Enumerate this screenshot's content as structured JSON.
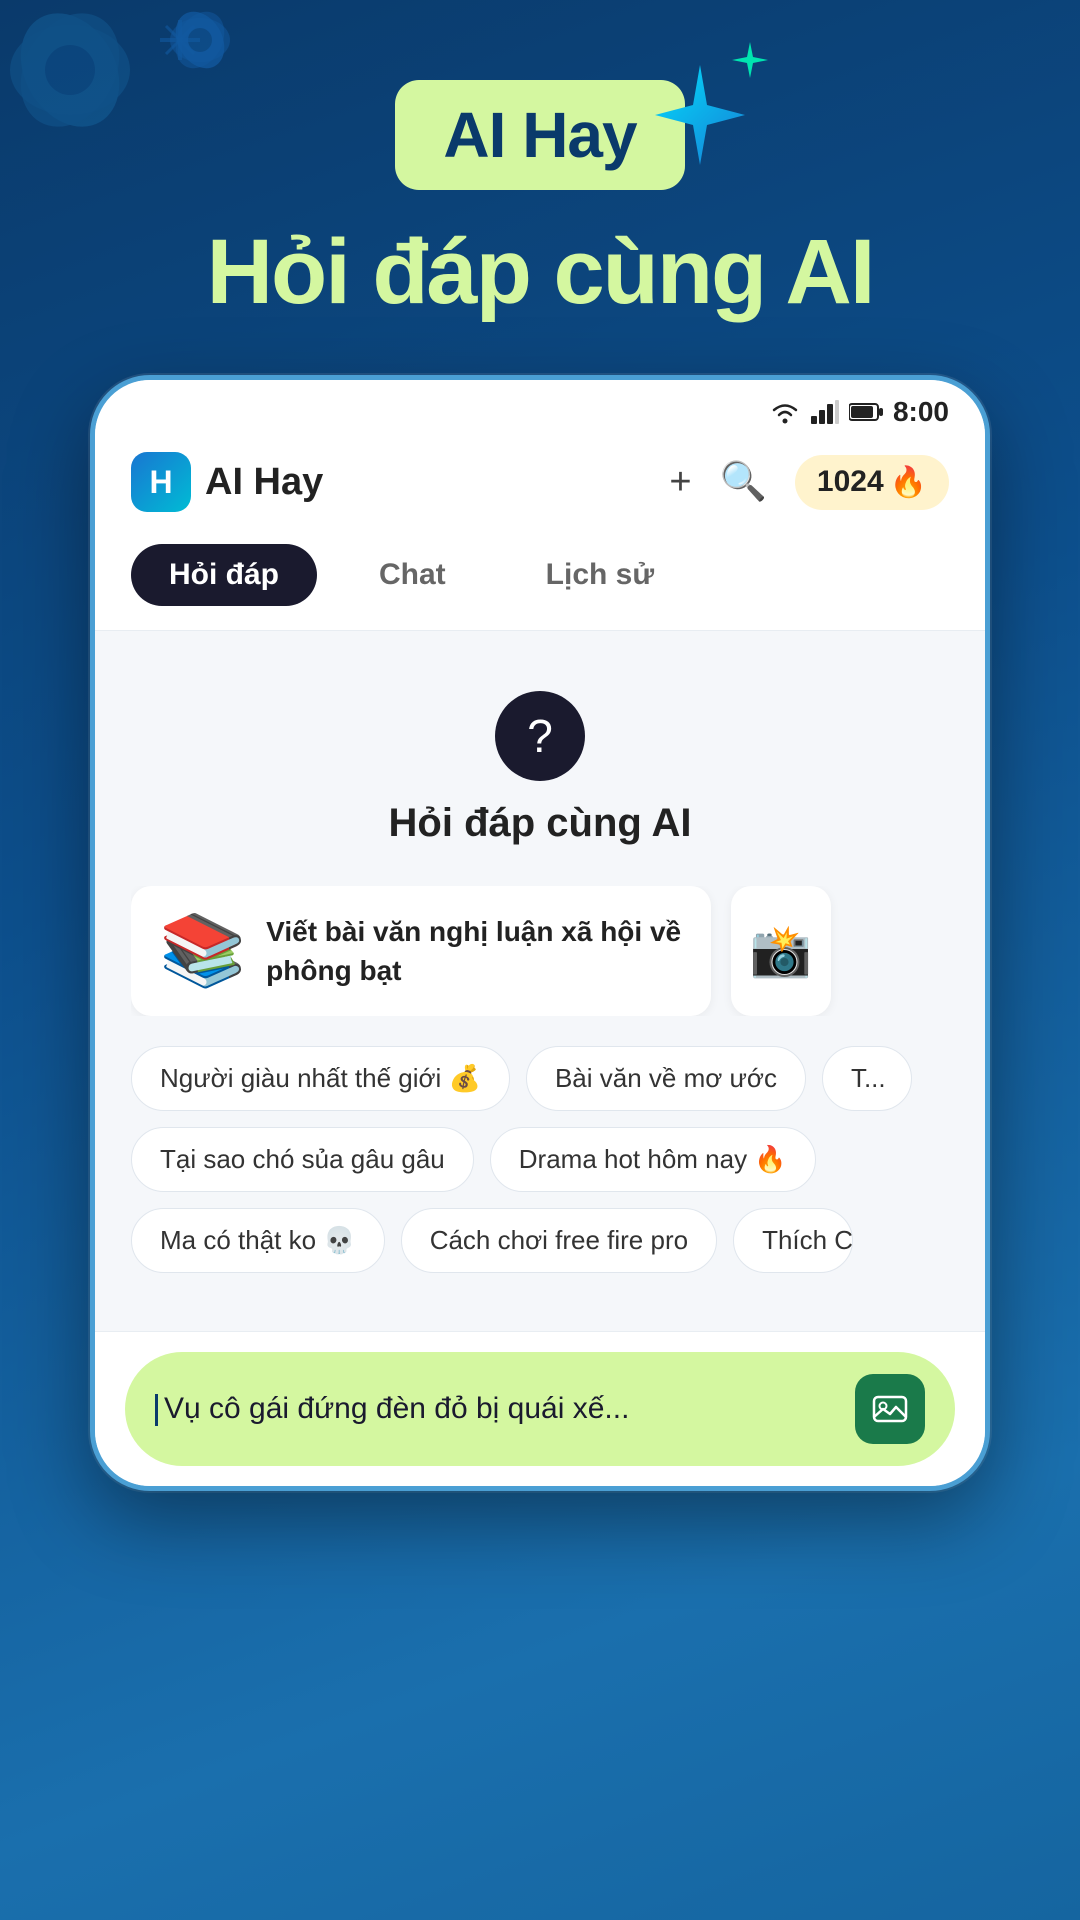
{
  "background": {
    "gradient_start": "#0a3a6b",
    "gradient_end": "#1565a0"
  },
  "hero": {
    "brand_label": "AI Hay",
    "subtitle": "Hỏi đáp cùng AI"
  },
  "status_bar": {
    "time": "8:00",
    "wifi_icon": "wifi",
    "signal_icon": "signal",
    "battery_icon": "battery"
  },
  "app_header": {
    "logo_letter": "H",
    "app_name": "AI Hay",
    "plus_icon": "+",
    "search_icon": "🔍",
    "coins_count": "1024",
    "coins_icon": "🔥"
  },
  "tabs": [
    {
      "id": "hoi-dap",
      "label": "Hỏi đáp",
      "active": true
    },
    {
      "id": "chat",
      "label": "Chat",
      "active": false
    },
    {
      "id": "lich-su",
      "label": "Lịch sử",
      "active": false
    }
  ],
  "main_section": {
    "question_icon": "?",
    "title": "Hỏi đáp cùng AI"
  },
  "suggestion_cards": [
    {
      "emoji": "📚",
      "text": "Viết bài văn nghị luận xã hội về phông bạt"
    },
    {
      "emoji": "📸",
      "text": ""
    }
  ],
  "tag_chips_row1": [
    {
      "text": "Người giàu nhất thế giới 💰"
    },
    {
      "text": "Bài văn về mơ ước"
    },
    {
      "text": "T",
      "partial": true
    }
  ],
  "tag_chips_row2": [
    {
      "text": "Tại sao chó sủa gâu gâu"
    },
    {
      "text": "Drama hot hôm nay 🔥"
    }
  ],
  "tag_chips_row3": [
    {
      "text": "Ma có thật ko 💀"
    },
    {
      "text": "Cách chơi free fire pro"
    },
    {
      "text": "Thích C",
      "partial": true
    }
  ],
  "input_bar": {
    "placeholder_text": "Vụ cô gái đứng đèn đỏ bị quái xế...",
    "image_icon": "🖼️"
  }
}
